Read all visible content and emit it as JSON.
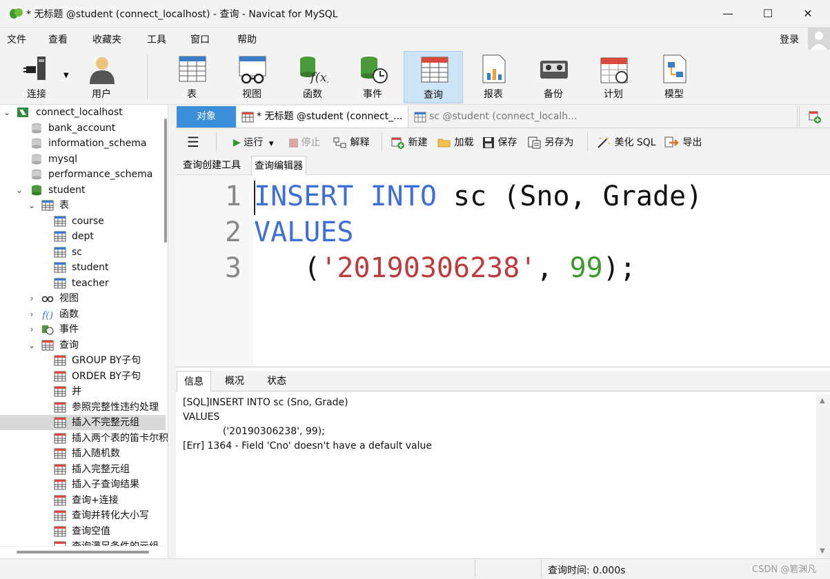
{
  "window": {
    "title": "* 无标题 @student (connect_localhost) - 查询 - Navicat for MySQL",
    "minimize_glyph": "—",
    "maximize_glyph": "☐",
    "close_glyph": "✕"
  },
  "menu": {
    "items": [
      "文件",
      "查看",
      "收藏夹",
      "工具",
      "窗口",
      "帮助"
    ],
    "login": "登录"
  },
  "toolbar": {
    "buttons": [
      {
        "label": "连接",
        "icon": "plug-icon"
      },
      {
        "label": "用户",
        "icon": "user-icon"
      },
      {
        "label": "表",
        "icon": "table-icon"
      },
      {
        "label": "视图",
        "icon": "view-glasses-icon"
      },
      {
        "label": "函数",
        "icon": "function-icon"
      },
      {
        "label": "事件",
        "icon": "event-icon"
      },
      {
        "label": "查询",
        "icon": "query-icon"
      },
      {
        "label": "报表",
        "icon": "report-icon"
      },
      {
        "label": "备份",
        "icon": "backup-icon"
      },
      {
        "label": "计划",
        "icon": "schedule-icon"
      },
      {
        "label": "模型",
        "icon": "model-icon"
      }
    ],
    "active": "查询"
  },
  "tree": {
    "connection": "connect_localhost",
    "databases": [
      "bank_account",
      "information_schema",
      "mysql",
      "performance_schema",
      "student"
    ],
    "tables_label": "表",
    "tables": [
      "course",
      "dept",
      "sc",
      "student",
      "teacher"
    ],
    "views_label": "视图",
    "functions_label": "函数",
    "events_label": "事件",
    "queries_label": "查询",
    "queries": [
      "GROUP BY子句",
      "ORDER BY子句",
      "并",
      "参照完整性违约处理",
      "插入不完整元组",
      "插入两个表的笛卡尔积",
      "插入随机数",
      "插入完整元组",
      "插入子查询结果",
      "查询+连接",
      "查询并转化大小写",
      "查询空值",
      "查询满足条件的元组"
    ],
    "selected_query": "插入不完整元组"
  },
  "tabs": {
    "objects": "对象",
    "doc1": "* 无标题 @student (connect_...",
    "doc2": "sc @student (connect_localh..."
  },
  "query_toolbar": {
    "run": "运行",
    "stop": "停止",
    "explain": "解释",
    "new": "新建",
    "load": "加载",
    "save": "保存",
    "save_as": "另存为",
    "beautify": "美化 SQL",
    "export": "导出"
  },
  "subtabs": {
    "builder": "查询创建工具",
    "editor": "查询编辑器"
  },
  "editor": {
    "line_numbers": [
      "1",
      "2",
      "3"
    ],
    "line1": {
      "kw1": "INSERT",
      "kw2": "INTO",
      "rest": " sc (Sno, Grade)"
    },
    "line2": {
      "kw": "VALUES"
    },
    "line3": {
      "open": "   (",
      "str": "'20190306238'",
      "sep": ", ",
      "num": "99",
      "close": ");"
    }
  },
  "results": {
    "tabs": [
      "信息",
      "概况",
      "状态"
    ],
    "active_tab": "信息",
    "messages": [
      "[SQL]INSERT INTO sc (Sno, Grade)",
      "VALUES",
      "             ('20190306238', 99);",
      "[Err] 1364 - Field 'Cno' doesn't have a default value"
    ]
  },
  "status": {
    "query_time": "查询时间: 0.000s",
    "watermark": "CSDN @箬渊凡"
  }
}
